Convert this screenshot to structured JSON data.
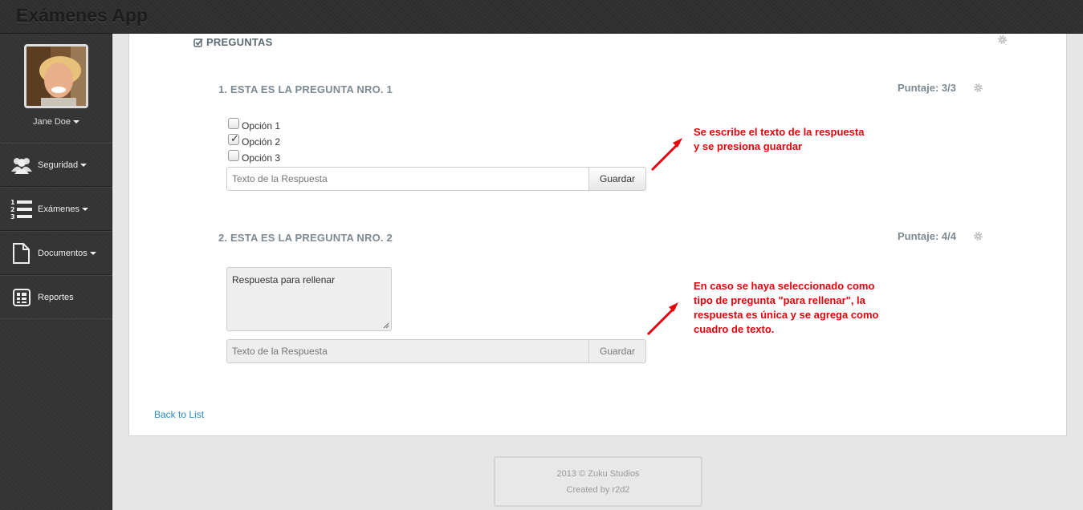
{
  "app": {
    "title": "Exámenes App"
  },
  "user": {
    "name": "Jane Doe"
  },
  "nav": [
    {
      "label": "Seguridad",
      "icon": "users-icon",
      "dropdown": true
    },
    {
      "label": "Exámenes",
      "icon": "numbered-list-icon",
      "dropdown": true
    },
    {
      "label": "Documentos",
      "icon": "document-icon",
      "dropdown": true
    },
    {
      "label": "Reportes",
      "icon": "report-icon",
      "dropdown": false
    }
  ],
  "section": {
    "title": "PREGUNTAS"
  },
  "questions": [
    {
      "title": "1. ESTA ES LA PREGUNTA NRO. 1",
      "score": "Puntaje: 3/3",
      "options": [
        {
          "label": "Opción 1",
          "checked": false
        },
        {
          "label": "Opción 2",
          "checked": true
        },
        {
          "label": "Opción 3",
          "checked": false
        }
      ],
      "input_placeholder": "Texto de la Respuesta",
      "button": "Guardar"
    },
    {
      "title": "2. ESTA ES LA PREGUNTA NRO. 2",
      "score": "Puntaje: 4/4",
      "textarea": "Respuesta para rellenar",
      "input_placeholder": "Texto de la Respuesta",
      "button": "Guardar"
    }
  ],
  "annotations": {
    "a1": [
      "Se escribe el texto de la respuesta",
      "y se presiona guardar"
    ],
    "a2": [
      "En caso se haya seleccionado como",
      "tipo de pregunta \"para rellenar\", la",
      "respuesta es única y se agrega como",
      "cuadro de texto."
    ]
  },
  "back_link": "Back to List",
  "footer": {
    "line1": "2013 © Zuku Studios",
    "line2": "Created by r2d2"
  },
  "colors": {
    "annotation": "#e8000b",
    "link": "#2a8bc1",
    "heading": "#7c8a93"
  }
}
